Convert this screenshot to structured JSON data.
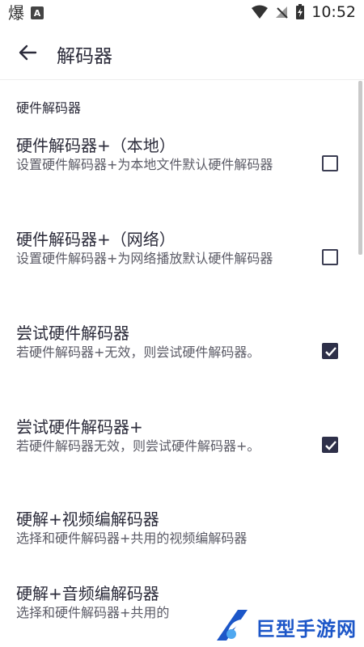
{
  "status_bar": {
    "notif_glyph": "爆",
    "a_badge": "A",
    "time": "10:52",
    "icons": [
      "flame-notification-icon",
      "a-notification-icon",
      "wifi-icon",
      "no-signal-icon",
      "battery-charging-icon"
    ]
  },
  "app_bar": {
    "title": "解码器"
  },
  "section": {
    "title": "硬件解码器"
  },
  "rows": [
    {
      "title": "硬件解码器+（本地）",
      "subtitle": "设置硬件解码器+为本地文件默认硬件解码器",
      "checked": false
    },
    {
      "title": "硬件解码器+（网络）",
      "subtitle": "设置硬件解码器+为网络播放默认硬件解码器",
      "checked": false
    },
    {
      "title": "尝试硬件解码器",
      "subtitle": "若硬件解码器+无效，则尝试硬件解码器。",
      "checked": true
    },
    {
      "title": "尝试硬件解码器+",
      "subtitle": "若硬件解码器无效，则尝试硬件解码器+。",
      "checked": true
    },
    {
      "title": "硬解+视频编解码器",
      "subtitle": "选择和硬件解码器+共用的视频编解码器"
    },
    {
      "title": "硬解+音频编解码器",
      "subtitle": "选择和硬件解码器+共用的"
    }
  ],
  "watermark": {
    "text": "巨型手游网"
  },
  "colors": {
    "checkbox": "#2e3049",
    "watermark_blue": "#1c56c8",
    "text": "#2b2b3a",
    "subtext": "#5b5b66"
  }
}
